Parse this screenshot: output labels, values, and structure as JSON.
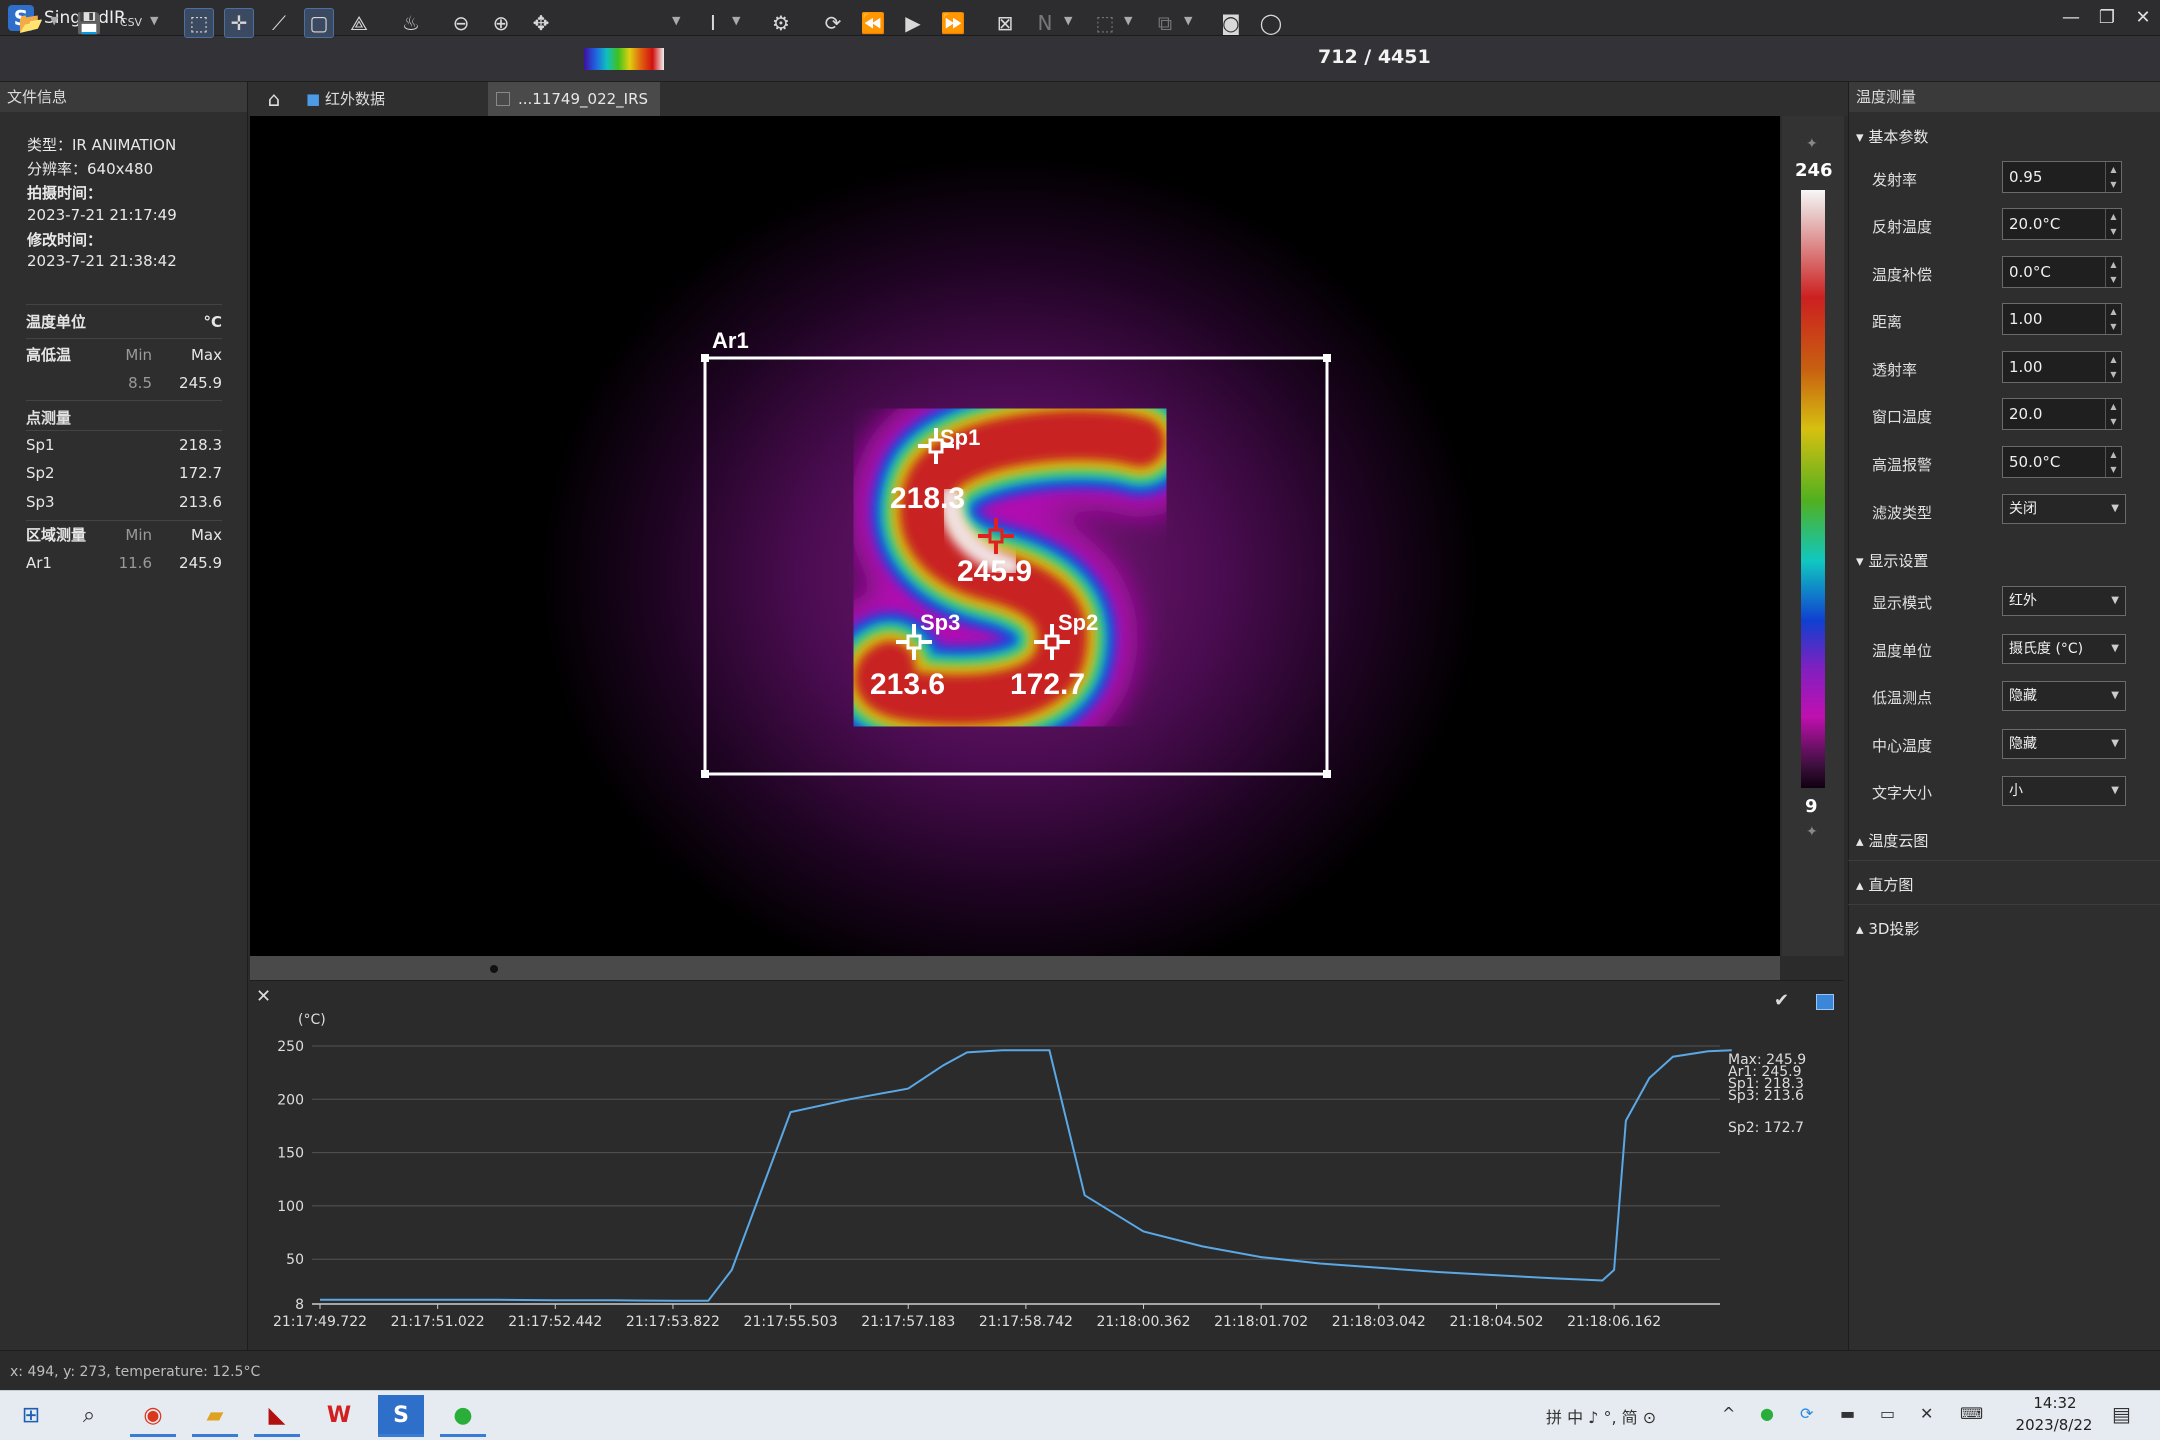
{
  "window": {
    "title": "SingardIR",
    "logo_letter": "S",
    "minimize": "—",
    "maximize": "❐",
    "close": "✕"
  },
  "toolbar": {
    "frame": "712 / 4451"
  },
  "left": {
    "header": "文件信息",
    "type": "类型：IR ANIMATION",
    "resolution": "分辨率：640x480",
    "shot_label": "拍摄时间：",
    "shot_time": "2023-7-21 21:17:49",
    "mod_label": "修改时间：",
    "mod_time": "2023-7-21 21:38:42",
    "unit_label": "温度单位",
    "unit_value": "°C",
    "hilo_label": "高低温",
    "min_h": "Min",
    "max_h": "Max",
    "hilo_min": "8.5",
    "hilo_max": "245.9",
    "point_label": "点测量",
    "points": [
      {
        "name": "Sp1",
        "value": "218.3"
      },
      {
        "name": "Sp2",
        "value": "172.7"
      },
      {
        "name": "Sp3",
        "value": "213.6"
      }
    ],
    "area_label": "区域测量",
    "area": {
      "name": "Ar1",
      "min": "11.6",
      "max": "245.9"
    }
  },
  "tabs": {
    "folder": "红外数据",
    "file": "...11749_022_IRS"
  },
  "image": {
    "area_label": "Ar1",
    "markers": [
      {
        "label": "Sp1",
        "value": "218.3"
      },
      {
        "label": "",
        "value": "245.9"
      },
      {
        "label": "Sp3",
        "value": "213.6"
      },
      {
        "label": "Sp2",
        "value": "172.7"
      }
    ]
  },
  "colorbar": {
    "max": "246",
    "min": "9"
  },
  "right": {
    "header": "温度测量",
    "basic": "基本参数",
    "params": [
      {
        "label": "发射率",
        "value": "0.95"
      },
      {
        "label": "反射温度",
        "value": "20.0°C"
      },
      {
        "label": "温度补偿",
        "value": "0.0°C"
      },
      {
        "label": "距离",
        "value": "1.00"
      },
      {
        "label": "透射率",
        "value": "1.00"
      },
      {
        "label": "窗口温度",
        "value": "20.0"
      },
      {
        "label": "高温报警",
        "value": "50.0°C"
      }
    ],
    "filter": {
      "label": "滤波类型",
      "value": "关闭"
    },
    "display": "显示设置",
    "display_items": [
      {
        "label": "显示模式",
        "value": "红外"
      },
      {
        "label": "温度单位",
        "value": "摄氏度 (°C)"
      },
      {
        "label": "低温测点",
        "value": "隐藏"
      },
      {
        "label": "中心温度",
        "value": "隐藏"
      },
      {
        "label": "文字大小",
        "value": "小"
      }
    ],
    "collapsed": [
      "温度云图",
      "直方图",
      "3D投影"
    ]
  },
  "chart_data": {
    "type": "line",
    "ylabel": "(°C)",
    "ylim": [
      8,
      250
    ],
    "yticks": [
      250,
      200,
      150,
      100,
      50,
      8
    ],
    "xticks": [
      "21:17:49.722",
      "21:17:51.022",
      "21:17:52.442",
      "21:17:53.822",
      "21:17:55.503",
      "21:17:57.183",
      "21:17:58.742",
      "21:18:00.362",
      "21:18:01.702",
      "21:18:03.042",
      "21:18:04.502",
      "21:18:06.162"
    ],
    "series": [
      {
        "name": "Ar1",
        "color": "#5aa8e6",
        "x": [
          0,
          0.5,
          1,
          1.5,
          2,
          2.5,
          3,
          3.3,
          3.5,
          4,
          4.5,
          5,
          5.3,
          5.5,
          5.8,
          6.2,
          6.5,
          7,
          7.5,
          8,
          8.5,
          9,
          9.5,
          10,
          10.5,
          10.9,
          11,
          11.1,
          11.3,
          11.5,
          11.8,
          12
        ],
        "y": [
          12,
          12,
          12,
          12,
          11.5,
          11.5,
          11,
          11,
          40,
          188,
          200,
          210,
          232,
          244,
          246,
          246,
          110,
          76,
          62,
          52,
          46,
          42,
          38,
          35,
          32,
          30,
          40,
          180,
          220,
          240,
          245,
          246
        ]
      }
    ],
    "legend": [
      "Max: 245.9",
      "Ar1: 245.9",
      "Sp1: 218.3",
      "Sp3: 213.6",
      "Sp2: 172.7"
    ]
  },
  "status": "x: 494, y: 273, temperature: 12.5°C",
  "taskbar": {
    "time": "14:32",
    "date": "2023/8/22",
    "ime": "拼 中 ♪ °, 简 ⊙"
  }
}
